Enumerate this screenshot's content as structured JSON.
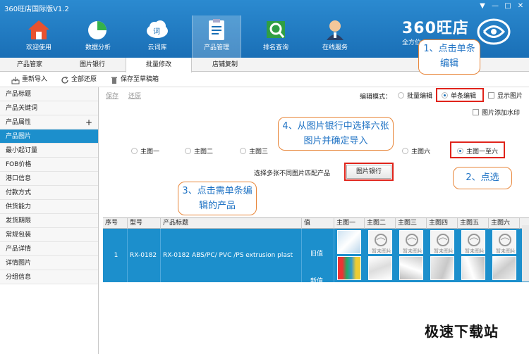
{
  "window": {
    "title": "360旺店国际版V1.2",
    "buttons": [
      "▼",
      "—",
      "□",
      "✕"
    ]
  },
  "nav": [
    {
      "label": "欢迎使用",
      "icon": "home-icon"
    },
    {
      "label": "数据分析",
      "icon": "pie-chart-icon"
    },
    {
      "label": "云词库",
      "icon": "cloud-word-icon"
    },
    {
      "label": "产品管理",
      "icon": "clipboard-icon"
    },
    {
      "label": "排名查询",
      "icon": "magnifier-icon"
    },
    {
      "label": "在线服务",
      "icon": "support-agent-icon"
    }
  ],
  "brand": {
    "name": "360旺店",
    "sub": "全方位"
  },
  "subtabs": [
    "产品管家",
    "图片银行",
    "批量修改",
    "店铺复制"
  ],
  "toolbar": {
    "reimport": "重新导入",
    "restore_all": "全部还原",
    "save_draft": "保存至草稿箱"
  },
  "sidebar": [
    "产品标题",
    "产品关键词",
    "产品属性",
    "产品图片",
    "最小起订量",
    "FOB价格",
    "港口信息",
    "付款方式",
    "供货能力",
    "发货期限",
    "常规包装",
    "产品详情",
    "详情图片",
    "分组信息"
  ],
  "main": {
    "save": "保存",
    "restore": "还原",
    "mode_label": "编辑模式：",
    "mode_batch": "批量编辑",
    "mode_single": "单条编辑",
    "show_images": "显示图片",
    "add_watermark": "图片添加水印",
    "img_options": [
      "主图一",
      "主图二",
      "主图三",
      "主图六",
      "主图一至六"
    ],
    "match_hint": "选择多张不同图片匹配产品",
    "image_bank_btn": "图片银行"
  },
  "callouts": {
    "c1": "1、点击单条编辑",
    "c2": "2、点选",
    "c3": "3、点击需单条编辑的产品",
    "c4": "4、从图片银行中选择六张图片并确定导入"
  },
  "table": {
    "headers": [
      "序号",
      "型号",
      "产品标题",
      "值",
      "主图一",
      "主图二",
      "主图三",
      "主图四",
      "主图五",
      "主图六"
    ],
    "row": {
      "no": "1",
      "model": "RX-0182",
      "title": "RX-0182 ABS/PC/ PVC /PS extrusion plast",
      "old": "旧值",
      "new": "新值"
    },
    "placeholder_text": "暂未图片"
  },
  "footer_watermark": "极速下载站"
}
